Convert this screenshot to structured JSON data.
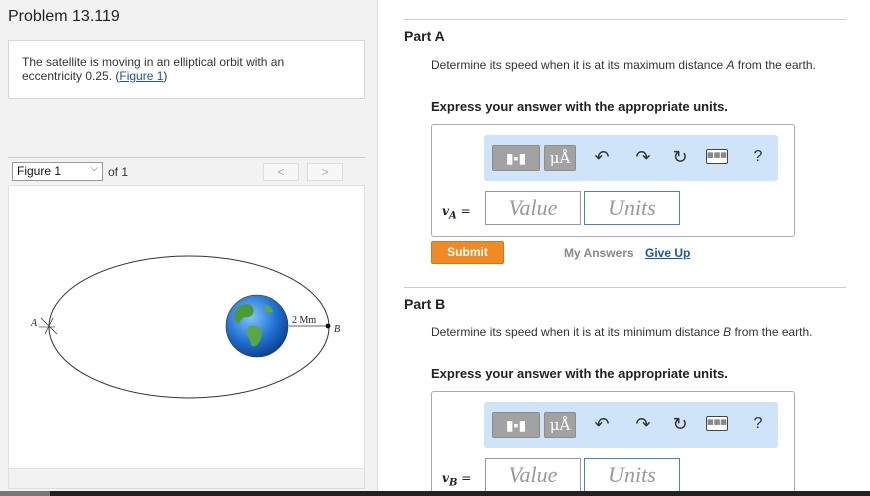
{
  "problem": {
    "title": "Problem 13.119",
    "text": "The satellite is moving in an elliptical orbit with an eccentricity 0.25.",
    "figure_link_open": "(",
    "figure_link": "Figure 1",
    "figure_link_close": ")"
  },
  "figure_nav": {
    "selected": "Figure 1",
    "of_label": "of 1",
    "prev": "<",
    "next": ">"
  },
  "figure": {
    "label_a": "A",
    "label_b": "B",
    "distance_label": "2 Mm"
  },
  "toolbar": {
    "frac_icon": "fraction-icon",
    "units_label": "μÅ",
    "undo_icon": "↶",
    "redo_icon": "↷",
    "reset_icon": "↻",
    "keyboard_icon": "⌨",
    "help_label": "?"
  },
  "part_a": {
    "title": "Part A",
    "question_pre": "Determine its speed when it is at its maximum distance ",
    "question_var": "A",
    "question_post": " from the earth.",
    "instruction": "Express your answer with the appropriate units.",
    "var_name": "v",
    "var_sub": "A",
    "equals": " =",
    "value_placeholder": "Value",
    "units_placeholder": "Units",
    "submit": "Submit",
    "my_answers": "My Answers",
    "give_up": "Give Up"
  },
  "part_b": {
    "title": "Part B",
    "question_pre": "Determine its speed when it is at its minimum distance ",
    "question_var": "B",
    "question_post": " from the earth.",
    "instruction": "Express your answer with the appropriate units.",
    "var_name": "v",
    "var_sub": "B",
    "equals": " =",
    "value_placeholder": "Value",
    "units_placeholder": "Units"
  }
}
